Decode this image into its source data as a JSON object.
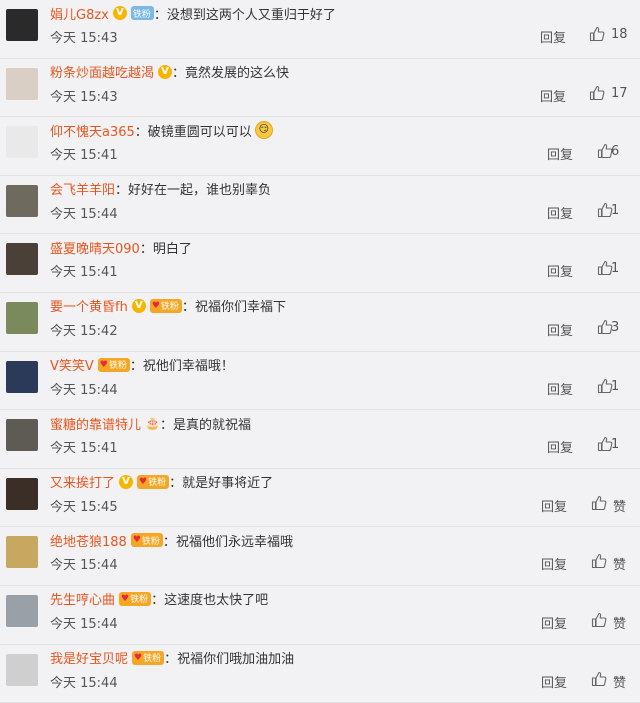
{
  "reply_label": "回复",
  "like_label_default": "赞",
  "comments": [
    {
      "name": "娟儿G8zx",
      "v": true,
      "badge": "铁粉",
      "badge_style": "blue",
      "text": "没想到这两个人又重归于好了",
      "time": "今天 15:43",
      "likes": "18",
      "avatar": "#2a2a2a"
    },
    {
      "name": "粉条炒面越吃越渴",
      "v": true,
      "badge": "",
      "text": "竟然发展的这么快",
      "time": "今天 15:43",
      "likes": "17",
      "avatar": "#d9cfc4"
    },
    {
      "name": "仰不愧天a365",
      "v": false,
      "badge": "",
      "text": "破镜重圆可以可以",
      "emoji": "smirk-emoji",
      "time": "今天 15:41",
      "likes": "6",
      "avatar": "#e9e9e9"
    },
    {
      "name": "会飞羊羊阳",
      "v": false,
      "badge": "",
      "text": "好好在一起，谁也别辜负",
      "time": "今天 15:44",
      "likes": "1",
      "avatar": "#6f6a5e"
    },
    {
      "name": "盛夏晚晴天090",
      "v": false,
      "badge": "",
      "text": "明白了",
      "time": "今天 15:41",
      "likes": "1",
      "avatar": "#4a4038"
    },
    {
      "name": "要一个黄昏fh",
      "v": true,
      "badge": "铁粉",
      "badge_style": "orange",
      "text": "祝福你们幸福下",
      "time": "今天 15:42",
      "likes": "3",
      "avatar": "#7a8a5c"
    },
    {
      "name": "V笑笑V",
      "v": false,
      "badge": "铁粉",
      "badge_style": "orange",
      "text": "祝他们幸福哦！",
      "time": "今天 15:44",
      "likes": "1",
      "avatar": "#2c3a5a"
    },
    {
      "name": "蜜糖的靠谱特儿",
      "v": false,
      "badge": "",
      "fan_emoji": true,
      "text": "是真的就祝福",
      "time": "今天 15:41",
      "likes": "1",
      "avatar": "#5e5a54"
    },
    {
      "name": "又来挨打了",
      "v": true,
      "badge": "铁粉",
      "badge_style": "orange",
      "text": "就是好事将近了",
      "time": "今天 15:45",
      "likes": "赞",
      "avatar": "#3a2e26"
    },
    {
      "name": "绝地苍狼188",
      "v": false,
      "badge": "铁粉",
      "badge_style": "orange",
      "text": "祝福他们永远幸福哦",
      "time": "今天 15:44",
      "likes": "赞",
      "avatar": "#c8a860"
    },
    {
      "name": "先生哼心曲",
      "v": false,
      "badge": "铁粉",
      "badge_style": "orange",
      "text": "这速度也太快了吧",
      "time": "今天 15:44",
      "likes": "赞",
      "avatar": "#9aa0a8"
    },
    {
      "name": "我是好宝贝呢",
      "v": false,
      "badge": "铁粉",
      "badge_style": "orange",
      "text": "祝福你们哦加油加油",
      "time": "今天 15:44",
      "likes": "赞",
      "avatar": "#cfcfcf"
    }
  ]
}
